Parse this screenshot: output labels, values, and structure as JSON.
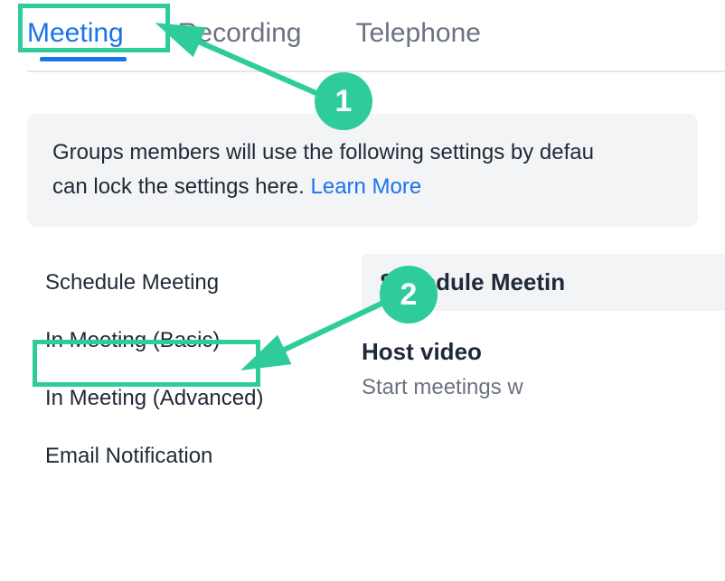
{
  "tabs": {
    "meeting": "Meeting",
    "recording": "Recording",
    "telephone": "Telephone"
  },
  "info": {
    "text_part1": "Groups members will use the following settings by defau",
    "text_part2": "can lock the settings here. ",
    "learn_more": "Learn More"
  },
  "sidebar": {
    "schedule_meeting": "Schedule Meeting",
    "in_meeting_basic": "In Meeting (Basic)",
    "in_meeting_advanced": "In Meeting (Advanced)",
    "email_notification": "Email Notification"
  },
  "main": {
    "section_header": "Schedule Meetin",
    "host_video_title": "Host video",
    "host_video_desc": "Start meetings w"
  },
  "annotations": {
    "badge1": "1",
    "badge2": "2"
  }
}
